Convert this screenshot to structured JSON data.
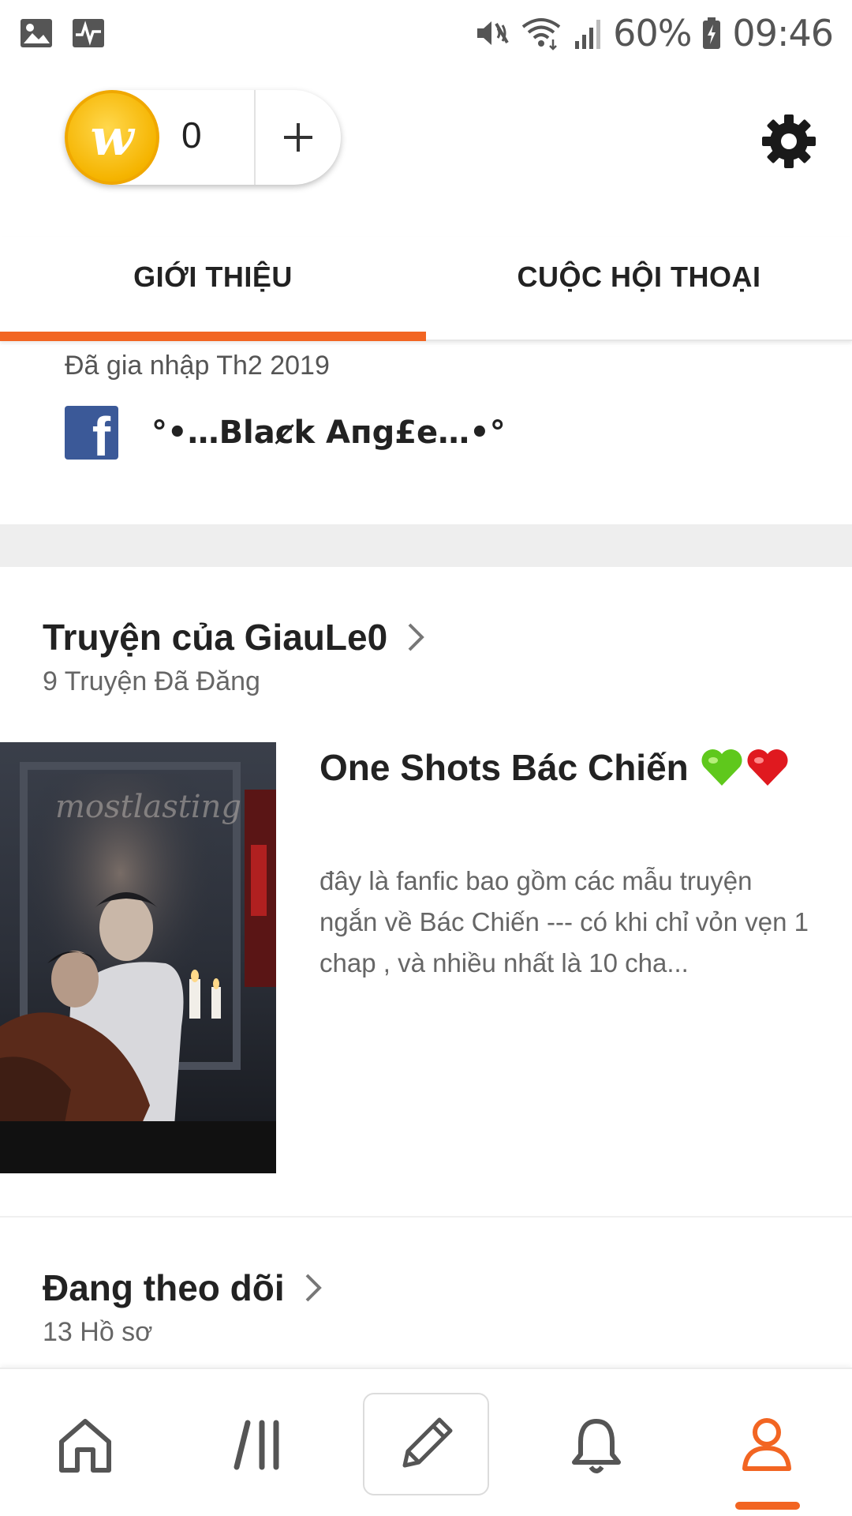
{
  "status_bar": {
    "battery": "60%",
    "time": "09:46",
    "icons": [
      "gallery-icon",
      "activity-icon",
      "mute-vibrate-icon",
      "wifi-icon",
      "signal-icon",
      "battery-charging-icon"
    ]
  },
  "header": {
    "coin_count": "0",
    "coin_letter": "w",
    "add_coins_icon": "plus-icon",
    "settings_icon": "gear-icon"
  },
  "tabs": [
    {
      "label": "GIỚI THIỆU",
      "active": true
    },
    {
      "label": "CUỘC HỘI THOẠI",
      "active": false
    }
  ],
  "about": {
    "joined": "Đã gia nhập Th2 2019",
    "facebook_name": "°•…Blaȼk Aпg£e…•°"
  },
  "stories_section": {
    "title": "Truyện của GiauLe0",
    "subtitle": "9 Truyện Đã Đăng",
    "story": {
      "title": "One Shots Bác Chiến",
      "description": "đây là fanfic bao gồm các mẫu truyện ngắn về Bác Chiến --- có khi chỉ vỏn vẹn 1 chap ,  và nhiều nhất là 10 cha...",
      "cover_text": "mostlasting"
    }
  },
  "following_section": {
    "title": "Đang theo dõi",
    "subtitle": "13 Hồ sơ"
  },
  "bottom_nav": [
    {
      "name": "home-icon",
      "active": false
    },
    {
      "name": "library-icon",
      "active": false
    },
    {
      "name": "write-icon",
      "active": false
    },
    {
      "name": "notifications-icon",
      "active": false
    },
    {
      "name": "profile-icon",
      "active": true
    }
  ],
  "colors": {
    "accent": "#f26522",
    "facebook": "#3b5998",
    "coin": "#f5b400"
  }
}
